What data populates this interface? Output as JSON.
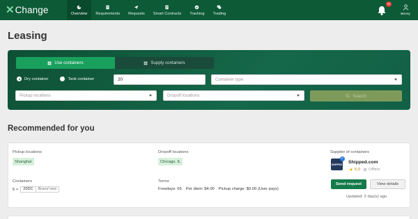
{
  "brand": {
    "name": "Change",
    "mark": "✕"
  },
  "nav": {
    "items": [
      {
        "label": "Overview",
        "icon": "dashboard-icon"
      },
      {
        "label": "Requirements",
        "icon": "clipboard-icon"
      },
      {
        "label": "Requests",
        "icon": "paper-plane-icon"
      },
      {
        "label": "Smart Contracts",
        "icon": "contract-icon"
      },
      {
        "label": "Tracking",
        "icon": "check-circle-icon"
      },
      {
        "label": "Trading",
        "icon": "chat-icon"
      }
    ],
    "active": "Overview"
  },
  "notifications": {
    "count": "31"
  },
  "user": {
    "name": "Benny"
  },
  "page": {
    "title": "Leasing"
  },
  "search": {
    "tabs": {
      "use": "Use containers",
      "supply": "Supply containers"
    },
    "radio": {
      "dry": "Dry container",
      "tank": "Tank container",
      "selected": "dry"
    },
    "quantity": "20",
    "container_type_placeholder": "Container type",
    "pickup_placeholder": "Pickup locations",
    "dropoff_placeholder": "Dropoff locations",
    "search_label": "Search"
  },
  "recommended": {
    "title": "Recommended for you",
    "card": {
      "pickup_label": "Pickup locations",
      "pickup_value": "Shanghai",
      "dropoff_label": "Dropoff locations",
      "dropoff_value": "Chicago, IL",
      "containers_label": "Containers",
      "container_qty": "5 ×",
      "container_size": "20DC",
      "container_condition": "Brand new",
      "terms_label": "Terms",
      "freedays": "Freedays: 65",
      "per_diem": "Per diem: $4.00",
      "pickup_charge": "Pickup charge: $0.00 (User pays)",
      "supplier_label": "Supplier of containers",
      "supplier_name": "Shipped.com",
      "supplier_logo_text": "SHIPPED",
      "supplier_rating": "5.0",
      "supplier_status": "Offline",
      "send_request": "Send request",
      "view_details": "View details",
      "updated": "Updated: 2 day(s) ago"
    }
  },
  "colors": {
    "brand_green": "#0d5a36",
    "accent_green": "#1aa05d",
    "button_green": "#157a4a",
    "tag_bg": "#d7f0dd",
    "badge_red": "#e53935"
  }
}
